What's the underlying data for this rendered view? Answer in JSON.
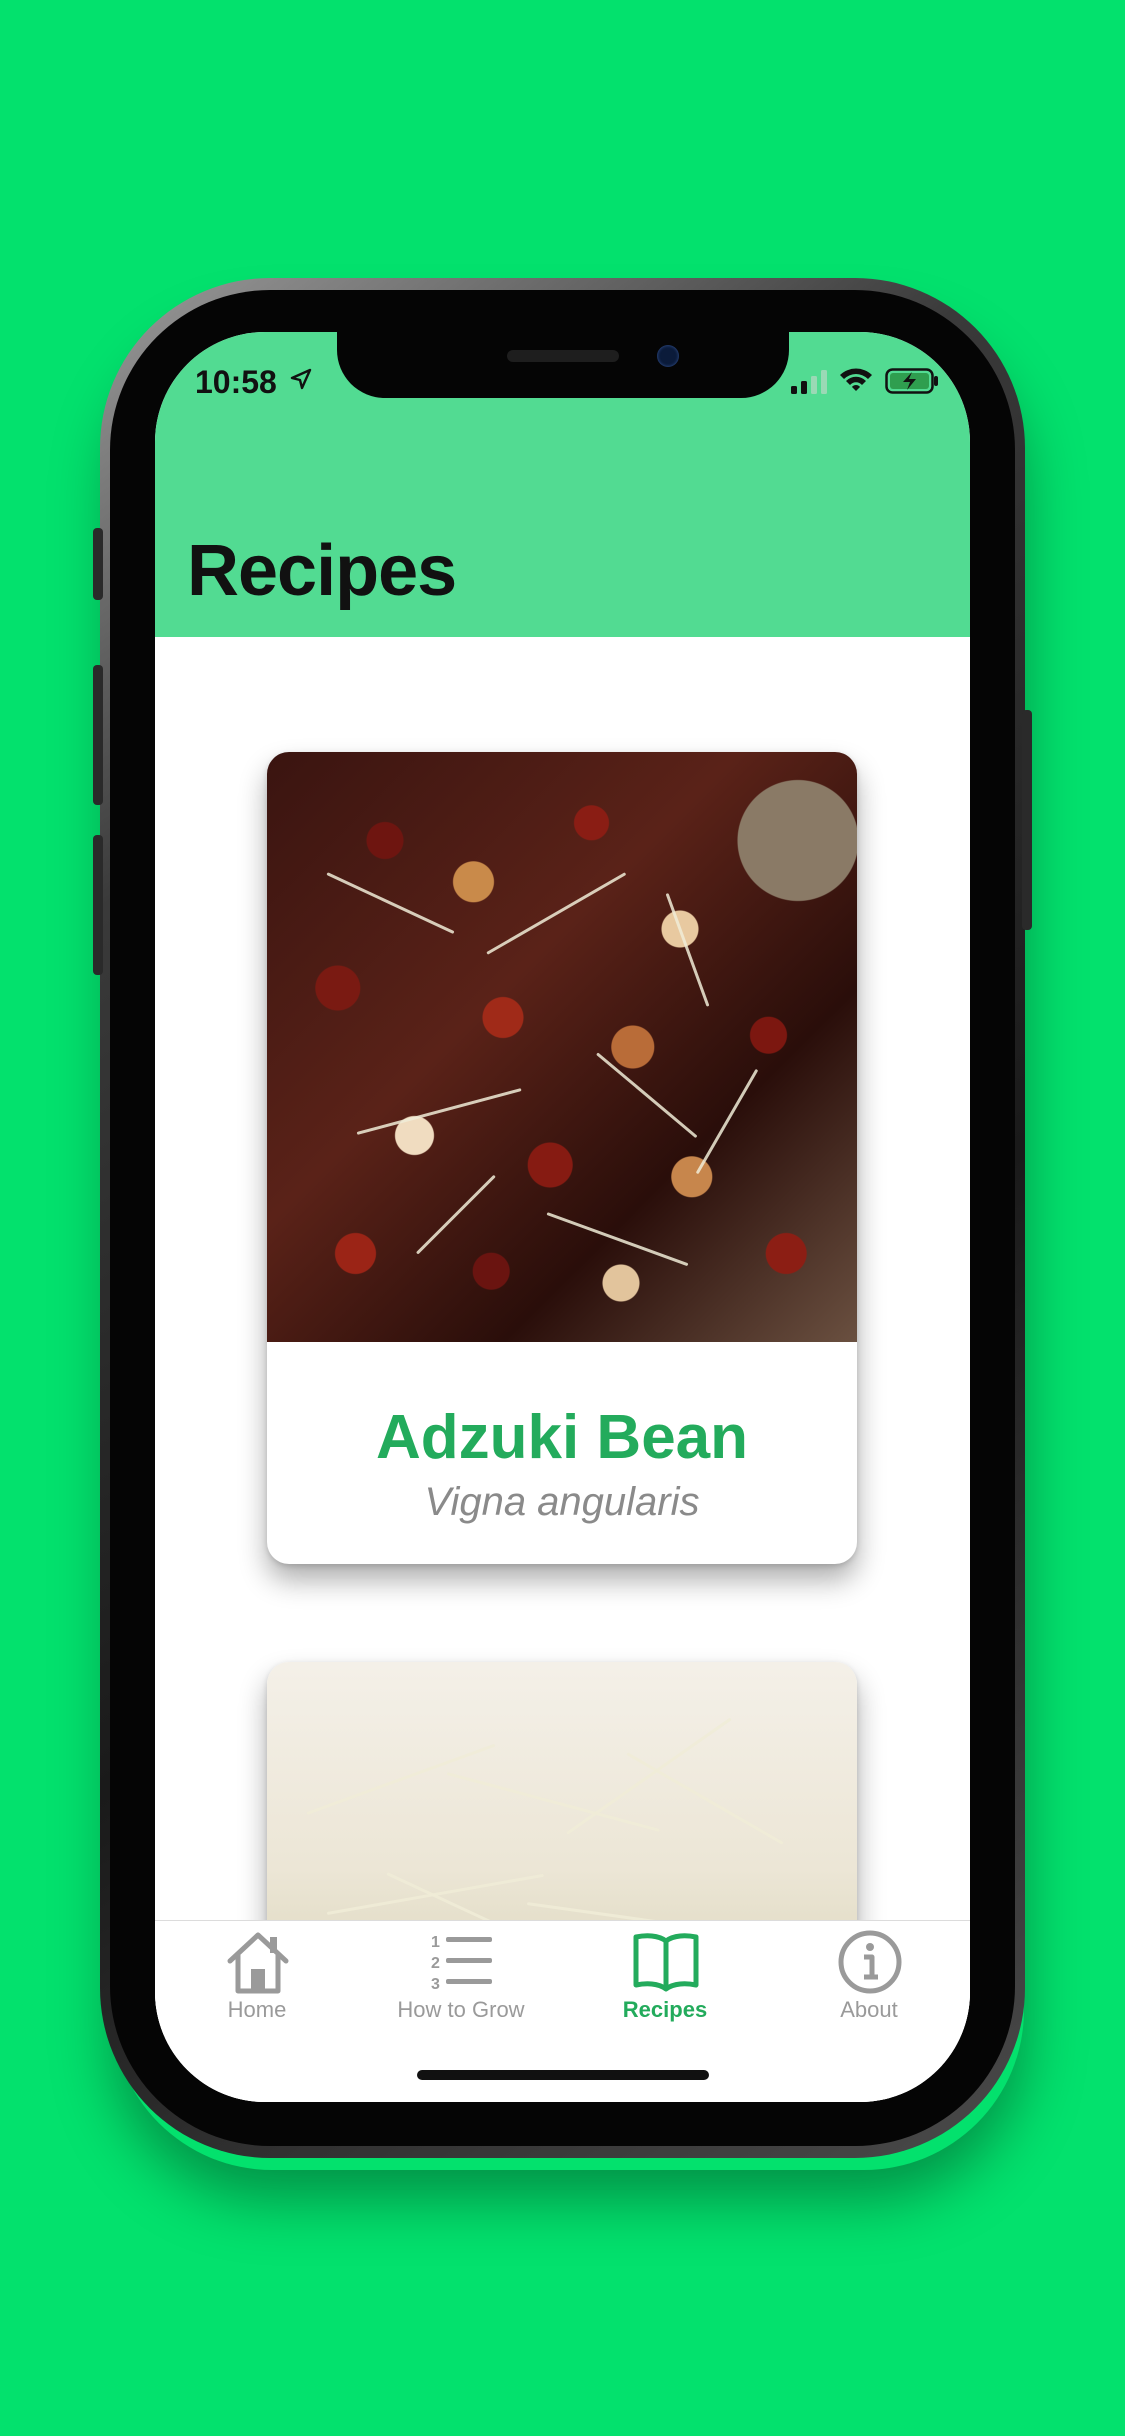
{
  "status_bar": {
    "time": "10:58"
  },
  "header": {
    "title": "Recipes"
  },
  "cards": [
    {
      "name": "Adzuki Bean",
      "scientific": "Vigna angularis",
      "photo": "adzuki-sprouts"
    },
    {
      "name": "",
      "scientific": "",
      "photo": "alfalfa-sprouts"
    }
  ],
  "tabbar": {
    "items": [
      {
        "label": "Home",
        "icon": "home-icon"
      },
      {
        "label": "How to Grow",
        "icon": "numbered-list-icon"
      },
      {
        "label": "Recipes",
        "icon": "book-icon",
        "active": true
      },
      {
        "label": "About",
        "icon": "info-icon"
      }
    ]
  },
  "colors": {
    "background": "#03e16d",
    "header": "#52db92",
    "accent": "#23ab5c",
    "inactive": "#9a9a9a"
  }
}
